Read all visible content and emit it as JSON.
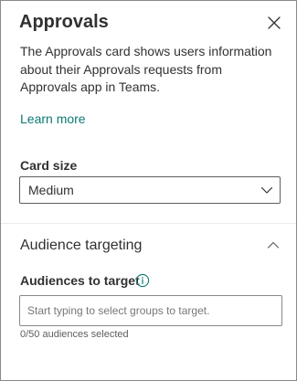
{
  "panel": {
    "title": "Approvals",
    "close_icon": "close-icon",
    "description": "The Approvals card shows users information about their Approvals requests from Approvals app in Teams.",
    "learn_more_label": "Learn more"
  },
  "card_size": {
    "label": "Card size",
    "selected": "Medium",
    "chevron_icon": "chevron-down-icon"
  },
  "audience_targeting": {
    "title": "Audience targeting",
    "chevron_icon": "chevron-up-icon",
    "expanded": true,
    "field_label": "Audiences to target",
    "info_icon": "info-icon",
    "input_placeholder": "Start typing to select groups to target.",
    "input_value": "",
    "count_text": "0/50 audiences selected"
  },
  "colors": {
    "link": "#0b7a75",
    "text": "#323130",
    "info_icon": "#0b7a75",
    "border": "#8a8886"
  }
}
